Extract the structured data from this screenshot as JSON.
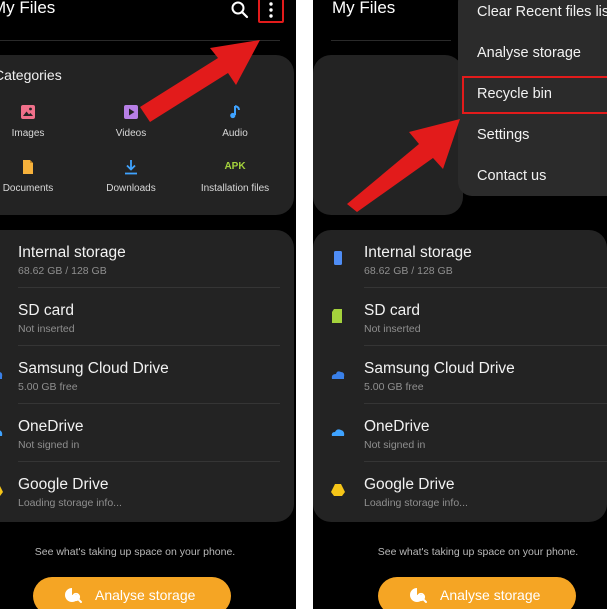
{
  "left_screen": {
    "title": "My Files",
    "categories": {
      "heading": "Categories",
      "items": [
        {
          "label": "Images",
          "icon": "image-icon",
          "color": "#f0708a"
        },
        {
          "label": "Videos",
          "icon": "video-icon",
          "color": "#b77fe6"
        },
        {
          "label": "Audio",
          "icon": "music-note-icon",
          "color": "#3fa3ff"
        },
        {
          "label": "Documents",
          "icon": "document-icon",
          "color": "#f6b13b"
        },
        {
          "label": "Downloads",
          "icon": "download-icon",
          "color": "#3fa3ff"
        },
        {
          "label": "Installation files",
          "icon": "apk-icon",
          "icon_text": "APK",
          "color": "#a4d23c"
        }
      ]
    }
  },
  "right_screen": {
    "title": "My Files",
    "menu": {
      "items": [
        {
          "label": "Clear Recent files list"
        },
        {
          "label": "Analyse storage"
        },
        {
          "label": "Recycle bin",
          "highlighted": true
        },
        {
          "label": "Settings"
        },
        {
          "label": "Contact us"
        }
      ]
    }
  },
  "storage": [
    {
      "title": "Internal storage",
      "subtitle": "68.62 GB / 128 GB",
      "icon": "phone-icon",
      "color": "#4f8df5"
    },
    {
      "title": "SD card",
      "subtitle": "Not inserted",
      "icon": "sd-card-icon",
      "color": "#a4d23c"
    },
    {
      "title": "Samsung Cloud Drive",
      "subtitle": "5.00 GB free",
      "icon": "samsung-cloud-icon",
      "color": "#3a80e8"
    },
    {
      "title": "OneDrive",
      "subtitle": "Not signed in",
      "icon": "onedrive-icon",
      "color": "#3fa3ff"
    },
    {
      "title": "Google Drive",
      "subtitle": "Loading storage info...",
      "icon": "google-drive-icon",
      "color": "#f5c518"
    }
  ],
  "hint_text": "See what's taking up space on your phone.",
  "analyse_button": "Analyse storage",
  "colors": {
    "background": "#000000",
    "card": "#232323",
    "accent": "#f5a524",
    "annotation": "#e21b1b"
  }
}
